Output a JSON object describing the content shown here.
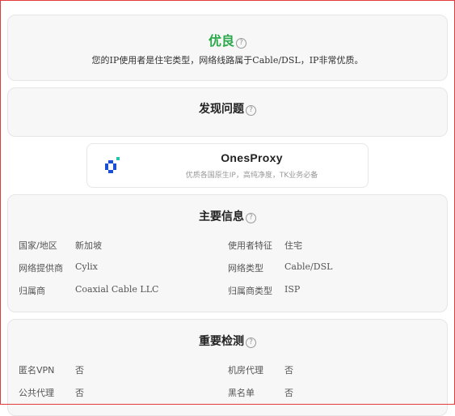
{
  "summary": {
    "rating": "优良",
    "description": "您的IP使用者是住宅类型，网络线路属于Cable/DSL，IP非常优质。"
  },
  "issues": {
    "title": "发现问题"
  },
  "ad": {
    "name": "OnesProxy",
    "tagline": "优质各国原生IP，高纯净度，TK业务必备"
  },
  "main_info": {
    "title": "主要信息",
    "left": [
      {
        "label": "国家/地区",
        "value": "新加坡"
      },
      {
        "label": "网络提供商",
        "value": "Cylix"
      },
      {
        "label": "归属商",
        "value": "Coaxial Cable LLC"
      }
    ],
    "right": [
      {
        "label": "使用者特征",
        "value": "住宅"
      },
      {
        "label": "网络类型",
        "value": "Cable/DSL"
      },
      {
        "label": "归属商类型",
        "value": "ISP"
      }
    ]
  },
  "checks": {
    "title": "重要检测",
    "left": [
      {
        "label": "匿名VPN",
        "value": "否"
      },
      {
        "label": "公共代理",
        "value": "否"
      }
    ],
    "right": [
      {
        "label": "机房代理",
        "value": "否"
      },
      {
        "label": "黑名单",
        "value": "否"
      }
    ]
  },
  "colors": {
    "rating": "#2aa84a",
    "ad_logo": "#1a4fd6",
    "ad_logo_accent": "#21c7a8"
  },
  "icons": [
    "help-circle-icon",
    "onesproxy-logo-icon"
  ]
}
